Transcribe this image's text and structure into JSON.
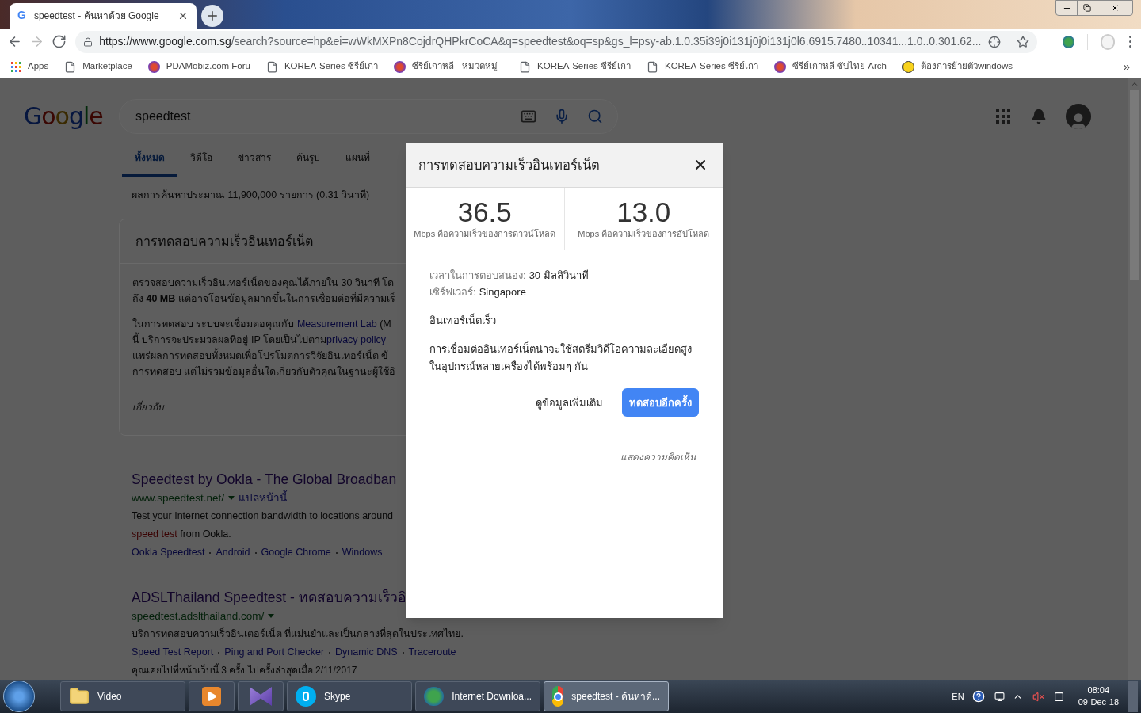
{
  "browser": {
    "tab": {
      "title": "speedtest - ค้นหาด้วย Google",
      "favicon": "G"
    },
    "nav_buttons": [
      {
        "kind": "back",
        "disabled": false
      },
      {
        "kind": "forward",
        "disabled": true
      },
      {
        "kind": "reload",
        "disabled": false
      }
    ],
    "address": {
      "host": "https://www.google.com.sg",
      "rest": "/search?source=hp&ei=wWkMXPn8CojdrQHPkrCoCA&q=speedtest&oq=sp&gs_l=psy-ab.1.0.35i39j0i131j0j0i131j0l6.6915.7480..10341...1.0..0.301.62..."
    },
    "bookmarks": [
      {
        "kind": "apps",
        "label": "Apps"
      },
      {
        "kind": "page",
        "label": "Marketplace"
      },
      {
        "kind": "site",
        "label": "PDAMobiz.com Foru"
      },
      {
        "kind": "page",
        "label": "KOREA-Series ซีรีย์เกา"
      },
      {
        "kind": "site",
        "label": "ซีรีย์เกาหลี - หมวดหมู่ -"
      },
      {
        "kind": "page",
        "label": "KOREA-Series ซีรีย์เกา"
      },
      {
        "kind": "page",
        "label": "KOREA-Series ซีรีย์เกา"
      },
      {
        "kind": "site",
        "label": "ซีรีย์เกาหลี ซับไทย Arch"
      },
      {
        "kind": "smiley",
        "label": "ต้องการย้ายตัวwindows"
      }
    ],
    "bookmarks_more": "»"
  },
  "page": {
    "logo": "Google",
    "query": "speedtest",
    "nav_tabs": [
      {
        "label": "ทั้งหมด",
        "selected": true
      },
      {
        "label": "วิดีโอ",
        "selected": false
      },
      {
        "label": "ข่าวสาร",
        "selected": false
      },
      {
        "label": "ค้นรูป",
        "selected": false
      },
      {
        "label": "แผนที่",
        "selected": false
      }
    ],
    "result_stats": "ผลการค้นหาประมาณ 11,900,000 รายการ (0.31 วินาที)",
    "speedtest_card": {
      "title": "การทดสอบความเร็วอินเทอร์เน็ต",
      "paragraphs": [
        [
          [
            {
              "kind": "text",
              "text": "ตรวจสอบความเร็วอินเทอร์เน็ตของคุณได้ภายใน 30 วินาที โด"
            }
          ],
          [
            {
              "kind": "text",
              "text": "ถึง **40 MB** แต่อาจโอนข้อมูลมากขึ้นในการเชื่อมต่อที่มีความเร็"
            }
          ]
        ],
        [
          [
            {
              "kind": "text",
              "text": "ในการทดสอบ ระบบจะเชื่อมต่อคุณกับ "
            },
            {
              "kind": "link",
              "text": "Measurement Lab"
            },
            {
              "kind": "text",
              "text": " (M"
            }
          ],
          [
            {
              "kind": "text",
              "text": "นี้ บริการจะประมวลผลที่อยู่ IP โดยเป็นไปตาม"
            },
            {
              "kind": "link",
              "text": "privacy policy"
            }
          ],
          [
            {
              "kind": "text",
              "text": "แพร่ผลการทดสอบทั้งหมดเพื่อโปรโมตการวิจัยอินเทอร์เน็ต ข้"
            }
          ],
          [
            {
              "kind": "text",
              "text": "การทดสอบ แต่ไม่รวมข้อมูลอื่นใดเกี่ยวกับตัวคุณในฐานะผู้ใช้อิ"
            }
          ]
        ]
      ],
      "footer": "เกี่ยวกับ"
    },
    "results": [
      {
        "title": "Speedtest by Ookla - The Global Broadban",
        "url": "www.speedtest.net/",
        "translate": "แปลหน้านี้",
        "snippet": [
          [
            {
              "kind": "text",
              "text": "Test your Internet connection bandwidth to locations around"
            }
          ],
          [
            {
              "kind": "em",
              "text": "speed test"
            },
            {
              "kind": "text",
              "text": " from Ookla."
            }
          ]
        ],
        "sitelinks": [
          "Ookla Speedtest",
          "Android",
          "Google Chrome",
          "Windows"
        ]
      },
      {
        "title": "ADSLThailand Speedtest - ทดสอบความเร็วอิ",
        "url": "speedtest.adslthailand.com/",
        "snippet": [
          [
            {
              "kind": "text",
              "text": "บริการทดสอบความเร็วอินเตอร์เน็ต ที่แม่นยำและเป็นกลางที่สุดในประเทศไทย."
            }
          ]
        ],
        "sitelinks": [
          "Speed Test Report",
          "Ping and Port Checker",
          "Dynamic DNS",
          "Traceroute"
        ],
        "visited": "คุณเคยไปที่หน้าเว็บนี้ 3 ครั้ง ไปครั้งล่าสุดเมื่อ 2/11/2017"
      }
    ]
  },
  "dialog": {
    "title": "การทดสอบความเร็วอินเทอร์เน็ต",
    "metrics": [
      {
        "value": "36.5",
        "label": "Mbps คือความเร็วของการดาวน์โหลด"
      },
      {
        "value": "13.0",
        "label": "Mbps คือความเร็วของการอัปโหลด"
      }
    ],
    "details": [
      {
        "label": "เวลาในการตอบสนอง:",
        "value": "30 มิลลิวินาที"
      },
      {
        "label": "เซิร์ฟเวอร์:",
        "value": "Singapore"
      }
    ],
    "verdict": "อินเทอร์เน็ตเร็ว",
    "description": "การเชื่อมต่ออินเทอร์เน็ตน่าจะใช้สตรีมวิดีโอความละเอียดสูงในอุปกรณ์หลายเครื่องได้พร้อมๆ กัน",
    "buttons": [
      {
        "kind": "text",
        "label": "ดูข้อมูลเพิ่มเติม"
      },
      {
        "kind": "primary",
        "label": "ทดสอบอีกครั้ง"
      }
    ],
    "feedback": "แสดงความคิดเห็น"
  },
  "taskbar": {
    "items": [
      {
        "kind": "folder",
        "label": "Video",
        "selected": false
      },
      {
        "kind": "media",
        "selected": false
      },
      {
        "kind": "vs",
        "selected": false
      },
      {
        "kind": "skype",
        "label": "Skype",
        "selected": false
      },
      {
        "kind": "idm",
        "label": "Internet Downloa...",
        "selected": false
      },
      {
        "kind": "chrome",
        "label": "speedtest - ค้นหาด้...",
        "selected": true
      }
    ],
    "language": "EN",
    "time": "08:04",
    "date": "09-Dec-18"
  }
}
